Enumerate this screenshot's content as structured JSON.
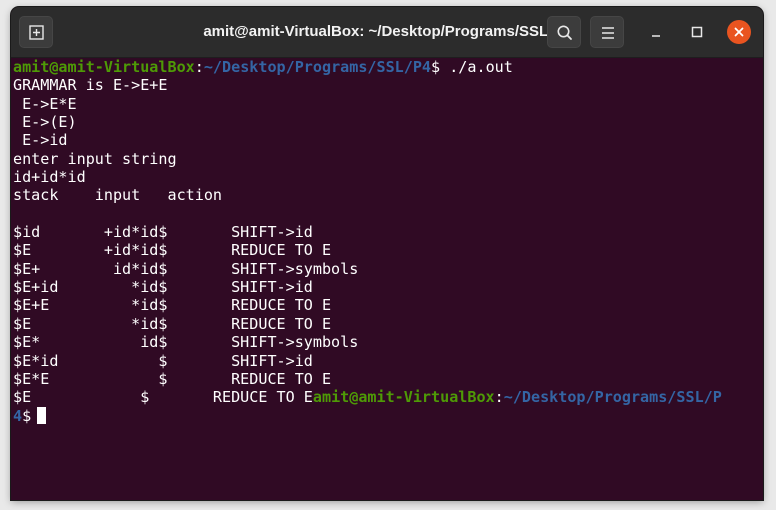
{
  "window": {
    "title": "amit@amit-VirtualBox: ~/Desktop/Programs/SSL/P4"
  },
  "icons": {
    "new_tab": "new-tab-icon",
    "search": "search-icon",
    "menu": "hamburger-menu-icon",
    "minimize": "minimize-icon",
    "maximize": "maximize-icon",
    "close": "close-icon",
    "close_color": "#e95420"
  },
  "colors": {
    "background": "#300a24",
    "prompt_user": "#4e9a06",
    "prompt_path": "#3465a4",
    "text": "#ffffff"
  },
  "terminal": {
    "prompt1": {
      "user": "amit@amit-VirtualBox",
      "sep": ":",
      "path": "~/Desktop/Programs/SSL/P4",
      "symbol": "$ ",
      "command": "./a.out"
    },
    "output": [
      "GRAMMAR is E->E+E",
      " E->E*E",
      " E->(E)",
      " E->id",
      "enter input string",
      "id+id*id",
      "stack    input   action",
      "",
      "$id       +id*id$       SHIFT->id",
      "$E        +id*id$       REDUCE TO E",
      "$E+        id*id$       SHIFT->symbols",
      "$E+id        *id$       SHIFT->id",
      "$E+E         *id$       REDUCE TO E",
      "$E           *id$       REDUCE TO E",
      "$E*           id$       SHIFT->symbols",
      "$E*id           $       SHIFT->id",
      "$E*E            $       REDUCE TO E"
    ],
    "last_line": {
      "text": "$E            $       REDUCE TO E",
      "user": "amit@amit-VirtualBox",
      "sep": ":",
      "path_part1": "~/Desktop/Programs/SSL/P",
      "path_part2": "4",
      "symbol": "$"
    }
  }
}
